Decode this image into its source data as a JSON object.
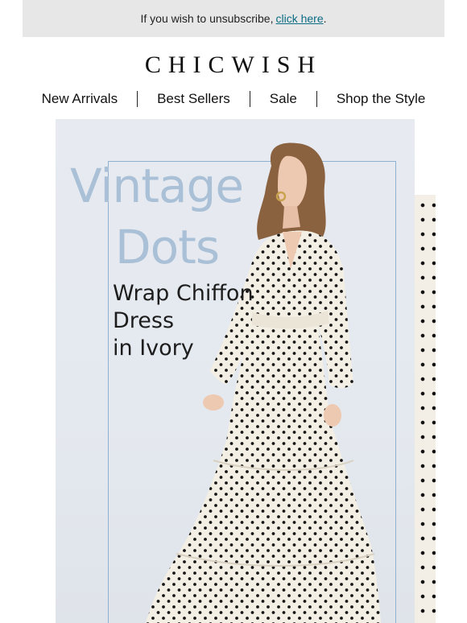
{
  "topbar": {
    "text": "If you wish to unsubscribe,",
    "link": "click here",
    "suffix": "."
  },
  "brand": {
    "logo": "CHICWISH"
  },
  "nav": {
    "items": [
      {
        "label": "New Arrivals"
      },
      {
        "label": "Best Sellers"
      },
      {
        "label": "Sale"
      },
      {
        "label": "Shop the Style"
      }
    ]
  },
  "hero": {
    "headline_line1": "Vintage",
    "headline_line2": "Dots",
    "subtitle_line1": "Wrap Chiffon",
    "subtitle_line2": "Dress",
    "subtitle_line3": "in Ivory",
    "image_description_icon": "polka-dot-dress-model-image"
  },
  "colors": {
    "topbar_bg": "#e7e7e7",
    "link": "#0b6c84",
    "headline": "#a9c0d7",
    "frame": "#8fb0ce",
    "hero_bg": "#e5eaf0",
    "dress": "#f4efe4"
  }
}
